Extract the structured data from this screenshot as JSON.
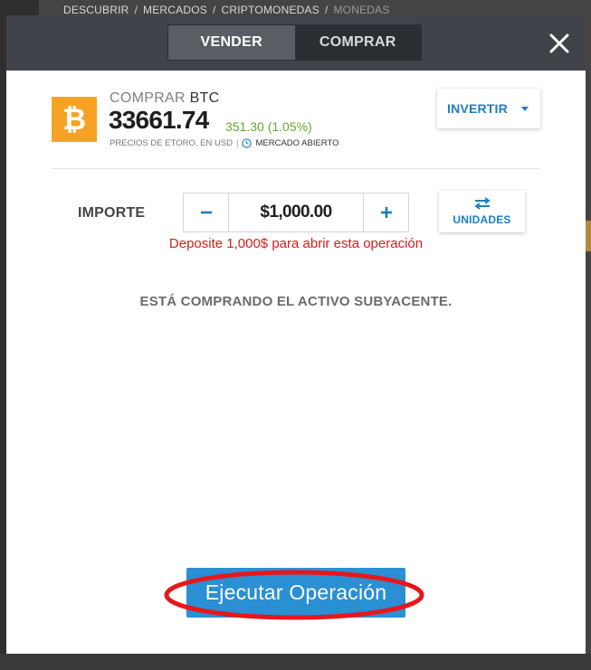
{
  "breadcrumb": {
    "items": [
      "DESCUBRIR",
      "MERCADOS",
      "CRIPTOMONEDAS",
      "MONEDAS"
    ],
    "separator": "/"
  },
  "header": {
    "tabs": [
      {
        "label": "VENDER",
        "active": true
      },
      {
        "label": "COMPRAR",
        "active": false
      }
    ],
    "close_icon": "close-icon"
  },
  "asset": {
    "action": "COMPRAR",
    "symbol": "BTC",
    "price": "33661.74",
    "change": "351.30 (1.05%)",
    "source_note": "PRECIOS DE ETORO, EN USD",
    "note_divider": "|",
    "market_status": "MERCADO ABIERTO",
    "icon": "bitcoin-icon",
    "icon_color": "#f7a225",
    "change_color": "#6aa531"
  },
  "invest_dropdown": {
    "label": "INVERTIR"
  },
  "amount": {
    "label": "IMPORTE",
    "value": "$1,000.00",
    "units_label": "UNIDADES",
    "deposit_message": "Deposite 1,000$ para abrir esta operación"
  },
  "info_text": "ESTÁ COMPRANDO EL ACTIVO SUBYACENTE.",
  "execute_button": {
    "label": "Ejecutar Operación",
    "color": "#2b8fd4"
  },
  "annotation": {
    "ring_color": "#e8161b"
  }
}
